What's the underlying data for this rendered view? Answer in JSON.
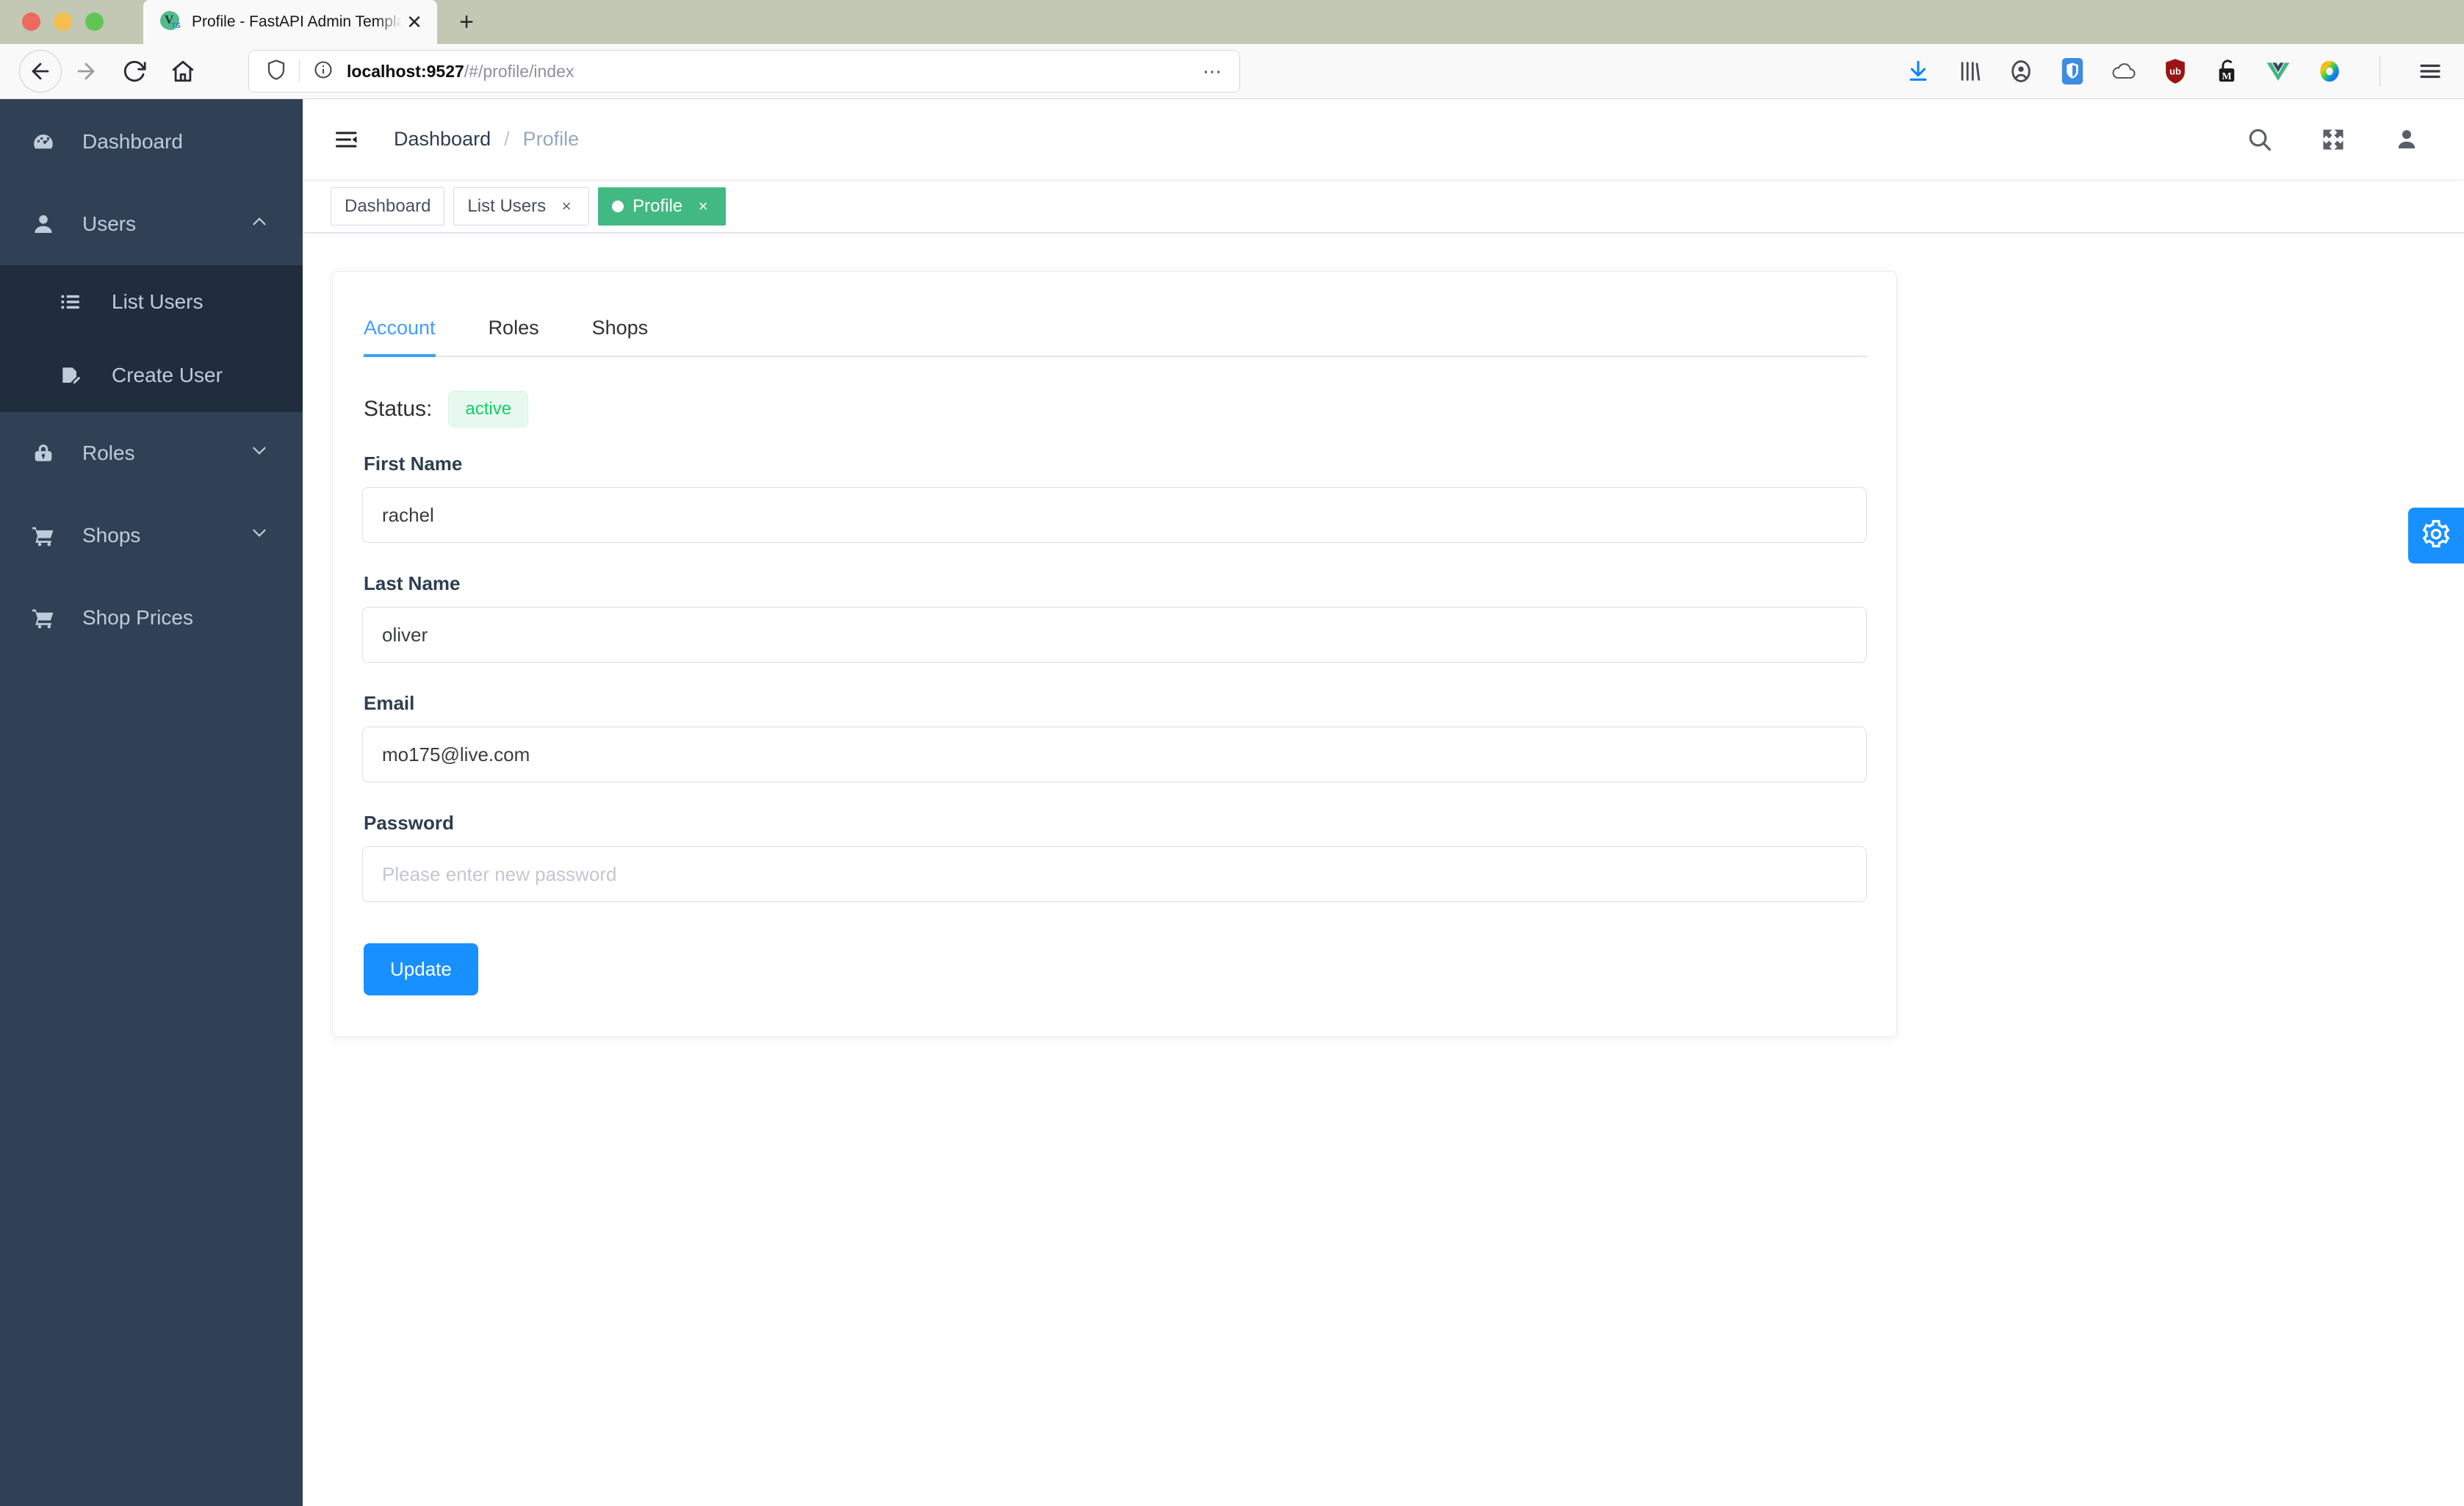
{
  "browser": {
    "tab_title": "Profile - FastAPI Admin Template",
    "favicon_letter": "V",
    "favicon_sub": "TS",
    "url_host": "localhost:9527",
    "url_path": "/#/profile/index",
    "new_tab_label": "+",
    "tab_close_label": "✕",
    "ellipsis_label": "⋯",
    "extensions": [
      "download-icon",
      "library-icon",
      "account-icon",
      "bitwarden-icon",
      "cloud-icon",
      "ublock-icon",
      "metamask-lock-icon",
      "vue-devtools-icon",
      "color-picker-icon"
    ],
    "menu_icon": "hamburger-menu-icon"
  },
  "sidebar": {
    "items": [
      {
        "label": "Dashboard",
        "icon": "dashboard-icon",
        "arrow": "",
        "active": false
      },
      {
        "label": "Users",
        "icon": "user-icon",
        "arrow": "chevron-up-icon",
        "active": true
      },
      {
        "label": "Roles",
        "icon": "lock-icon",
        "arrow": "chevron-down-icon",
        "active": false
      },
      {
        "label": "Shops",
        "icon": "cart-icon",
        "arrow": "chevron-down-icon",
        "active": false
      },
      {
        "label": "Shop Prices",
        "icon": "cart-icon",
        "arrow": "",
        "active": false
      }
    ],
    "submenu": [
      {
        "label": "List Users",
        "icon": "list-icon"
      },
      {
        "label": "Create User",
        "icon": "document-edit-icon"
      }
    ]
  },
  "header": {
    "hamburger": "collapse-menu-icon",
    "breadcrumb": {
      "root": "Dashboard",
      "separator": "/",
      "current": "Profile"
    },
    "actions": [
      "search-icon",
      "fullscreen-icon",
      "avatar-icon"
    ]
  },
  "tagsview": {
    "tags": [
      {
        "label": "Dashboard",
        "closable": false,
        "active": false
      },
      {
        "label": "List Users",
        "closable": true,
        "active": false
      },
      {
        "label": "Profile",
        "closable": true,
        "active": true
      }
    ],
    "close_glyph": "×"
  },
  "card": {
    "tabs": [
      {
        "label": "Account",
        "active": true
      },
      {
        "label": "Roles",
        "active": false
      },
      {
        "label": "Shops",
        "active": false
      }
    ],
    "status": {
      "label": "Status:",
      "value": "active"
    },
    "fields": [
      {
        "label": "First Name",
        "value": "rachel",
        "placeholder": ""
      },
      {
        "label": "Last Name",
        "value": "oliver",
        "placeholder": ""
      },
      {
        "label": "Email",
        "value": "mo175@live.com",
        "placeholder": ""
      },
      {
        "label": "Password",
        "value": "",
        "placeholder": "Please enter new password"
      }
    ],
    "submit_label": "Update"
  },
  "fab": {
    "icon": "gear-icon"
  },
  "colors": {
    "sidebar_bg": "#304156",
    "submenu_bg": "#1f2d3d",
    "accent_blue": "#409eff",
    "button_blue": "#1890ff",
    "tag_green": "#42b983",
    "status_green": "#13ce66",
    "titlebar": "#c2c8b4"
  }
}
